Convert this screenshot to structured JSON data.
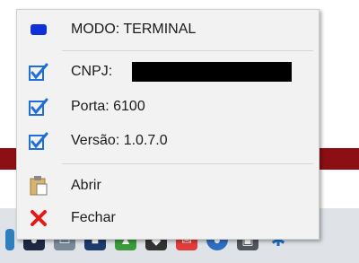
{
  "menu": {
    "items": [
      {
        "label": "MODO: TERMINAL",
        "icon": "blue-status-icon",
        "type": "status"
      },
      {
        "label": "CNPJ:",
        "icon": "checked-checkbox-icon",
        "type": "checked"
      },
      {
        "label": "Porta: 6100",
        "icon": "checked-checkbox-icon",
        "type": "checked"
      },
      {
        "label": "Versão: 1.0.7.0",
        "icon": "checked-checkbox-icon",
        "type": "checked"
      },
      {
        "label": "Abrir",
        "icon": "clipboard-icon",
        "type": "action"
      },
      {
        "label": "Fechar",
        "icon": "close-x-icon",
        "type": "action"
      }
    ]
  },
  "colors": {
    "checkbox_blue": "#1f6fd6",
    "status_blue": "#1030d8",
    "close_red": "#e21a1a",
    "background_red": "#8b0f14"
  }
}
